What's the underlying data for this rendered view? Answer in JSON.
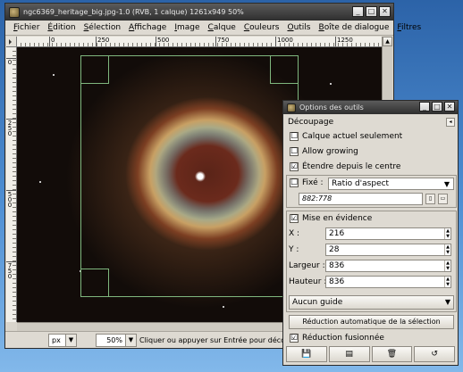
{
  "image_window": {
    "title": "ngc6369_heritage_big.jpg-1.0 (RVB, 1 calque) 1261x949 50%",
    "window_buttons": [
      "_",
      "□",
      "✕"
    ],
    "menus": [
      "Fichier",
      "Édition",
      "Sélection",
      "Affichage",
      "Image",
      "Calque",
      "Couleurs",
      "Outils",
      "Boîte de dialogue",
      "Filtres"
    ],
    "hruler_labels": [
      "0",
      "250",
      "500",
      "750",
      "1000",
      "1250"
    ],
    "vruler_labels": [
      "0",
      "250",
      "500",
      "750"
    ],
    "status": {
      "unit": "px",
      "zoom": "50%",
      "message": "Cliquer ou appuyer sur Entrée pour découper"
    }
  },
  "tool_options": {
    "title": "Options des outils",
    "window_buttons": [
      "_",
      "□",
      "✕"
    ],
    "tab_label": "Découpage",
    "current_layer_only": {
      "label": "Calque actuel seulement",
      "checked": "☐"
    },
    "allow_growing": {
      "label": "Allow growing",
      "checked": "☐"
    },
    "expand_from_center": {
      "label": "Étendre depuis le centre",
      "checked": "☑"
    },
    "fixed": {
      "label": "Fixé :",
      "checked": "☐",
      "mode": "Ratio d'aspect"
    },
    "ratio_value": "882:778",
    "highlight": {
      "label": "Mise en évidence",
      "checked": "☑"
    },
    "x": {
      "label": "X :",
      "value": "216"
    },
    "y": {
      "label": "Y :",
      "value": "28"
    },
    "width": {
      "label": "Largeur :",
      "value": "836"
    },
    "height": {
      "label": "Hauteur :",
      "value": "836"
    },
    "guides": "Aucun guide",
    "auto_shrink_button": "Réduction automatique de la sélection",
    "shrink_merged": {
      "label": "Réduction fusionnée",
      "checked": "☑"
    },
    "footer_icons": [
      "save-icon",
      "restore-icon",
      "delete-icon",
      "reset-icon"
    ]
  }
}
